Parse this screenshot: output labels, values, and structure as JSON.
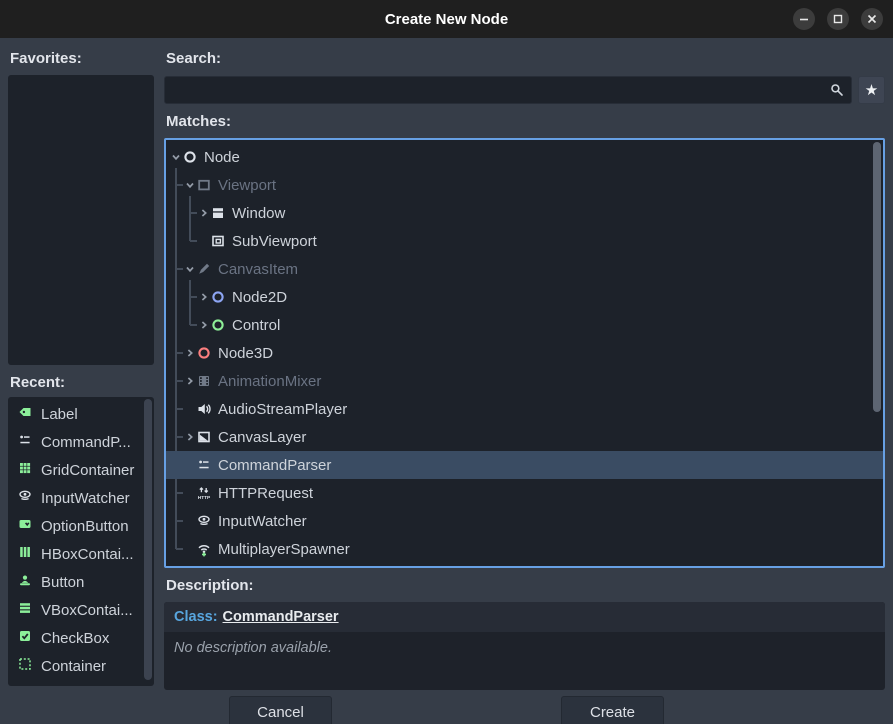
{
  "window": {
    "title": "Create New Node"
  },
  "window_controls": [
    {
      "name": "minimize"
    },
    {
      "name": "maximize"
    },
    {
      "name": "close"
    }
  ],
  "sections": {
    "favorites": "Favorites:",
    "search": "Search:",
    "matches": "Matches:",
    "recent": "Recent:",
    "description": "Description:"
  },
  "search": {
    "value": "",
    "placeholder": ""
  },
  "matches_tree": [
    {
      "label": "Node",
      "level": 0,
      "chevron": "down",
      "icon": "node",
      "disabled": false,
      "selected": false
    },
    {
      "label": "Viewport",
      "level": 1,
      "chevron": "down",
      "icon": "viewport",
      "disabled": true,
      "selected": false
    },
    {
      "label": "Window",
      "level": 2,
      "chevron": "right",
      "icon": "window",
      "disabled": false,
      "selected": false
    },
    {
      "label": "SubViewport",
      "level": 2,
      "chevron": null,
      "icon": "subviewport",
      "disabled": false,
      "selected": false
    },
    {
      "label": "CanvasItem",
      "level": 1,
      "chevron": "down",
      "icon": "canvasitem",
      "disabled": true,
      "selected": false
    },
    {
      "label": "Node2D",
      "level": 2,
      "chevron": "right",
      "icon": "node2d",
      "disabled": false,
      "selected": false
    },
    {
      "label": "Control",
      "level": 2,
      "chevron": "right",
      "icon": "control",
      "disabled": false,
      "selected": false
    },
    {
      "label": "Node3D",
      "level": 1,
      "chevron": "right",
      "icon": "node3d",
      "disabled": false,
      "selected": false
    },
    {
      "label": "AnimationMixer",
      "level": 1,
      "chevron": "right",
      "icon": "animationmixer",
      "disabled": true,
      "selected": false
    },
    {
      "label": "AudioStreamPlayer",
      "level": 1,
      "chevron": null,
      "icon": "audiostreamplayer",
      "disabled": false,
      "selected": false
    },
    {
      "label": "CanvasLayer",
      "level": 1,
      "chevron": "right",
      "icon": "canvaslayer",
      "disabled": false,
      "selected": false
    },
    {
      "label": "CommandParser",
      "level": 1,
      "chevron": null,
      "icon": "commandparser",
      "disabled": false,
      "selected": true
    },
    {
      "label": "HTTPRequest",
      "level": 1,
      "chevron": null,
      "icon": "httprequest",
      "disabled": false,
      "selected": false
    },
    {
      "label": "InputWatcher",
      "level": 1,
      "chevron": null,
      "icon": "inputwatcher",
      "disabled": false,
      "selected": false
    },
    {
      "label": "MultiplayerSpawner",
      "level": 1,
      "chevron": null,
      "icon": "multiplayerspawner",
      "disabled": false,
      "selected": false
    }
  ],
  "recent_list": [
    {
      "label": "Label",
      "icon": "label"
    },
    {
      "label": "CommandP...",
      "icon": "commandparser"
    },
    {
      "label": "GridContainer",
      "icon": "gridcontainer"
    },
    {
      "label": "InputWatcher",
      "icon": "inputwatcher"
    },
    {
      "label": "OptionButton",
      "icon": "optionbutton"
    },
    {
      "label": "HBoxContai...",
      "icon": "hboxcontainer"
    },
    {
      "label": "Button",
      "icon": "button"
    },
    {
      "label": "VBoxContai...",
      "icon": "vboxcontainer"
    },
    {
      "label": "CheckBox",
      "icon": "checkbox"
    },
    {
      "label": "Container",
      "icon": "container"
    }
  ],
  "description": {
    "class_label": "Class:",
    "class_name": "CommandParser",
    "body": "No description available."
  },
  "dialog_buttons": {
    "cancel": "Cancel",
    "create": "Create"
  },
  "colors": {
    "accent_focus": "#67a0e4",
    "selection": "#3a4c63",
    "icon_white": "#dde2e9",
    "icon_gray": "#717a88",
    "icon_green": "#8cef9a",
    "node2d_blue": "#8da5f3",
    "control_green": "#8eef97",
    "node3d_red": "#fc7f7f",
    "class_link_blue": "#58a6df"
  }
}
